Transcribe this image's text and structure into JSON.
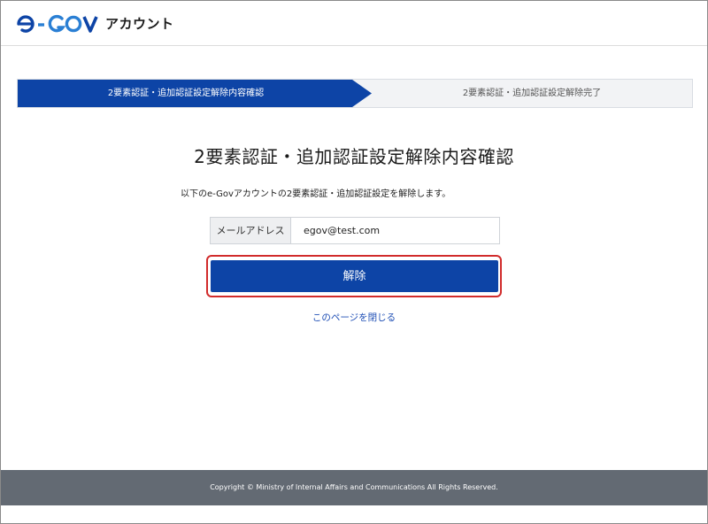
{
  "header": {
    "logo_text": "e-GOV",
    "logo_sub": "アカウント",
    "brand_color": "#0d44a6",
    "accent_color": "#2a7fd4"
  },
  "stepper": {
    "steps": [
      {
        "label": "2要素認証・追加認証設定解除内容確認",
        "active": true
      },
      {
        "label": "2要素認証・追加認証設定解除完了",
        "active": false
      }
    ]
  },
  "main": {
    "title": "2要素認証・追加認証設定解除内容確認",
    "description": "以下のe-Govアカウントの2要素認証・追加認証設定を解除します。",
    "email": {
      "label": "メールアドレス",
      "value": "egov@test.com"
    },
    "submit_label": "解除",
    "close_link": "このページを閉じる",
    "highlight_color": "#d12b2b"
  },
  "footer": {
    "copyright": "Copyright © Ministry of Internal Affairs and Communications All Rights Reserved."
  }
}
